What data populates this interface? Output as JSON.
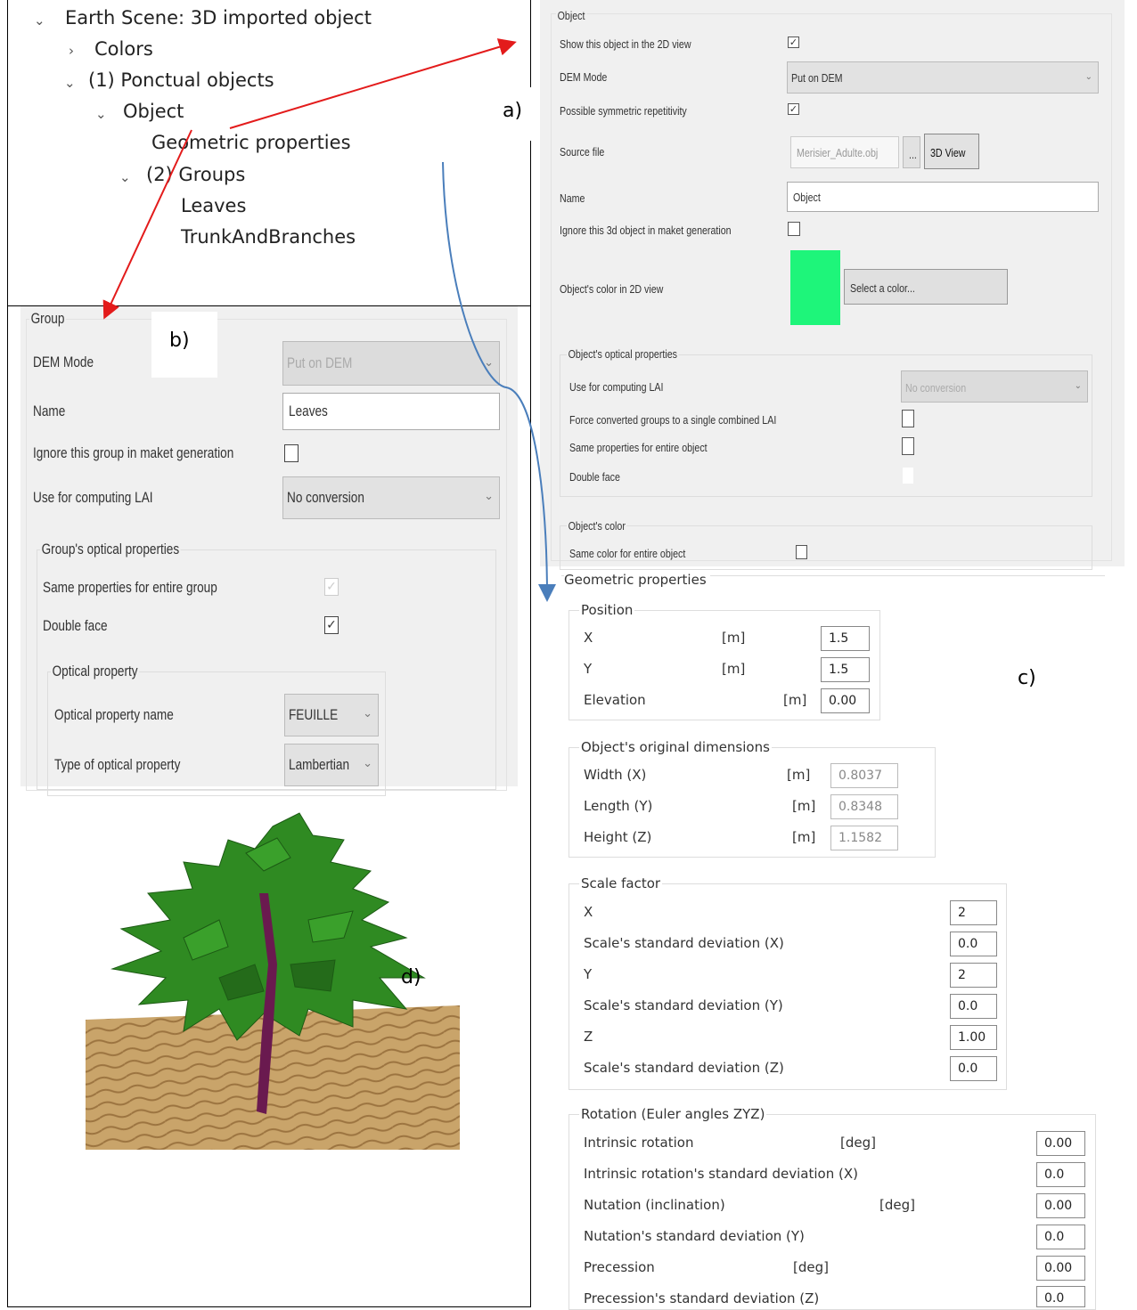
{
  "tree": {
    "items": [
      {
        "label": "Earth Scene: 3D imported object",
        "twisty": "⌄"
      },
      {
        "label": "Colors",
        "twisty": "›"
      },
      {
        "label": "(1) Ponctual objects",
        "twisty": "⌄"
      },
      {
        "label": "Object",
        "twisty": "⌄"
      },
      {
        "label": "Geometric properties",
        "twisty": ""
      },
      {
        "label": "(2) Groups",
        "twisty": "⌄"
      },
      {
        "label": "Leaves",
        "twisty": ""
      },
      {
        "label": "TrunkAndBranches",
        "twisty": ""
      }
    ]
  },
  "labels": {
    "a": "a)",
    "b": "b)",
    "c": "c)",
    "d": "d)"
  },
  "object_panel": {
    "title": "Object",
    "show_2d_label": "Show this object in the 2D view",
    "show_2d_checked": true,
    "dem_mode_label": "DEM Mode",
    "dem_mode_value": "Put on DEM",
    "symmetric_label": "Possible symmetric repetitivity",
    "symmetric_checked": true,
    "source_file_label": "Source file",
    "source_file_value": "Merisier_Adulte.obj",
    "browse_label": "...",
    "view3d_label": "3D View",
    "name_label": "Name",
    "name_value": "Object",
    "ignore_label": "Ignore this 3d object in maket generation",
    "ignore_checked": false,
    "color_2d_label": "Object's color in 2D view",
    "color_2d_value": "#1ef57a",
    "select_color_label": "Select a color...",
    "optical_group_title": "Object's optical properties",
    "lai_label": "Use for computing LAI",
    "lai_value": "No conversion",
    "force_label": "Force converted groups to a single combined LAI",
    "same_props_label": "Same properties for entire object",
    "double_face_label": "Double face",
    "color_group_title": "Object's color",
    "same_color_label": "Same color for entire object"
  },
  "geometric": {
    "title": "Geometric properties",
    "position": {
      "title": "Position",
      "rows": [
        {
          "label": "X",
          "unit": "[m]",
          "value": "1.5"
        },
        {
          "label": "Y",
          "unit": "[m]",
          "value": "1.5"
        },
        {
          "label": "Elevation",
          "unit": "[m]",
          "value": "0.00"
        }
      ]
    },
    "dims": {
      "title": "Object's original dimensions",
      "rows": [
        {
          "label": "Width (X)",
          "unit": "[m]",
          "value": "0.8037"
        },
        {
          "label": "Length (Y)",
          "unit": "[m]",
          "value": "0.8348"
        },
        {
          "label": "Height (Z)",
          "unit": "[m]",
          "value": "1.1582"
        }
      ]
    },
    "scale": {
      "title": "Scale factor",
      "rows": [
        {
          "label": "X",
          "value": "2"
        },
        {
          "label": "Scale's standard deviation (X)",
          "value": "0.0"
        },
        {
          "label": "Y",
          "value": "2"
        },
        {
          "label": "Scale's standard deviation (Y)",
          "value": "0.0"
        },
        {
          "label": "Z",
          "value": "1.00"
        },
        {
          "label": "Scale's standard deviation (Z)",
          "value": "0.0"
        }
      ]
    },
    "rotation": {
      "title": "Rotation (Euler angles ZYZ)",
      "rows": [
        {
          "label": "Intrinsic rotation",
          "unit": "[deg]",
          "value": "0.00"
        },
        {
          "label": "Intrinsic rotation's standard deviation (X)",
          "unit": "",
          "value": "0.0"
        },
        {
          "label": "Nutation (inclination)",
          "unit": "[deg]",
          "value": "0.00"
        },
        {
          "label": "Nutation's standard deviation (Y)",
          "unit": "",
          "value": "0.0"
        },
        {
          "label": "Precession",
          "unit": "[deg]",
          "value": "0.00"
        },
        {
          "label": "Precession's standard deviation (Z)",
          "unit": "",
          "value": "0.0"
        }
      ]
    }
  },
  "group_panel": {
    "title": "Group",
    "dem_mode_label": "DEM Mode",
    "dem_mode_value": "Put on DEM",
    "name_label": "Name",
    "name_value": "Leaves",
    "ignore_label": "Ignore this group in maket generation",
    "lai_label": "Use for computing LAI",
    "lai_value": "No conversion",
    "optical_title": "Group's optical properties",
    "same_props_label": "Same properties for entire group",
    "double_face_label": "Double face",
    "double_face_checked": true,
    "optical_prop_title": "Optical property",
    "opt_name_label": "Optical property name",
    "opt_name_value": "FEUILLE",
    "opt_type_label": "Type of optical property",
    "opt_type_value": "Lambertian"
  },
  "colors": {
    "arrow_red": "#e31b1b",
    "arrow_blue": "#4a7ebb",
    "leaf": "#2f8a22",
    "trunk": "#6a1a4f",
    "ground": "#c9a46a"
  }
}
